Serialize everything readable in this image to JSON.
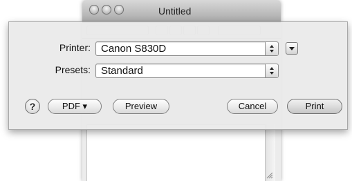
{
  "window": {
    "title": "Untitled"
  },
  "print_sheet": {
    "printer_label": "Printer:",
    "printer_value": "Canon S830D",
    "presets_label": "Presets:",
    "presets_value": "Standard",
    "help_label": "?",
    "pdf_label": "PDF ▾",
    "preview_label": "Preview",
    "cancel_label": "Cancel",
    "print_label": "Print"
  },
  "icons": [
    "close-icon",
    "minimize-icon",
    "zoom-icon",
    "popup-arrows-icon",
    "disclosure-triangle-icon",
    "resize-grip-icon"
  ]
}
